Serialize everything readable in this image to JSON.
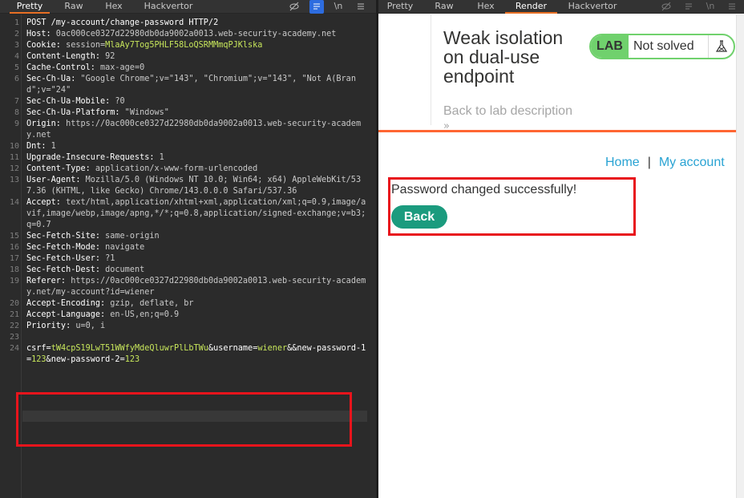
{
  "request_panel": {
    "tabs": [
      {
        "label": "Pretty",
        "active": true
      },
      {
        "label": "Raw",
        "active": false
      },
      {
        "label": "Hex",
        "active": false
      },
      {
        "label": "Hackvertor",
        "active": false
      }
    ],
    "toolbar_icons": [
      "eye-slash-icon",
      "wrap-lines-icon",
      "newline-icon",
      "menu-icon"
    ],
    "toolbar_newline_label": "\\n",
    "lines": [
      {
        "n": "1",
        "key": "POST /my-account/change-password HTTP/2",
        "val": ""
      },
      {
        "n": "2",
        "key": "Host:",
        "val": " 0ac000ce0327d22980db0da9002a0013.web-security-academy.net"
      },
      {
        "n": "3",
        "key": "Cookie:",
        "val": " session=",
        "green": "MlaAy7Tog5PHLF58LoQSRMMmqPJKlska"
      },
      {
        "n": "4",
        "key": "Content-Length:",
        "val": " 92"
      },
      {
        "n": "5",
        "key": "Cache-Control:",
        "val": " max-age=0"
      },
      {
        "n": "6",
        "key": "Sec-Ch-Ua:",
        "val": " \"Google Chrome\";v=\"143\", \"Chromium\";v=\"143\", \"Not A(Brand\";v=\"24\""
      },
      {
        "n": "7",
        "key": "Sec-Ch-Ua-Mobile:",
        "val": " ?0"
      },
      {
        "n": "8",
        "key": "Sec-Ch-Ua-Platform:",
        "val": " \"Windows\""
      },
      {
        "n": "9",
        "key": "Origin:",
        "val": " https://0ac000ce0327d22980db0da9002a0013.web-security-academy.net"
      },
      {
        "n": "10",
        "key": "Dnt:",
        "val": " 1"
      },
      {
        "n": "11",
        "key": "Upgrade-Insecure-Requests:",
        "val": " 1"
      },
      {
        "n": "12",
        "key": "Content-Type:",
        "val": " application/x-www-form-urlencoded"
      },
      {
        "n": "13",
        "key": "User-Agent:",
        "val": " Mozilla/5.0 (Windows NT 10.0; Win64; x64) AppleWebKit/537.36 (KHTML, like Gecko) Chrome/143.0.0.0 Safari/537.36"
      },
      {
        "n": "14",
        "key": "Accept:",
        "val": " text/html,application/xhtml+xml,application/xml;q=0.9,image/avif,image/webp,image/apng,*/*;q=0.8,application/signed-exchange;v=b3;q=0.7"
      },
      {
        "n": "15",
        "key": "Sec-Fetch-Site:",
        "val": " same-origin"
      },
      {
        "n": "16",
        "key": "Sec-Fetch-Mode:",
        "val": " navigate"
      },
      {
        "n": "17",
        "key": "Sec-Fetch-User:",
        "val": " ?1"
      },
      {
        "n": "18",
        "key": "Sec-Fetch-Dest:",
        "val": " document"
      },
      {
        "n": "19",
        "key": "Referer:",
        "val": " https://0ac000ce0327d22980db0da9002a0013.web-security-academy.net/my-account?id=wiener"
      },
      {
        "n": "20",
        "key": "Accept-Encoding:",
        "val": " gzip, deflate, br"
      },
      {
        "n": "21",
        "key": "Accept-Language:",
        "val": " en-US,en;q=0.9"
      },
      {
        "n": "22",
        "key": "Priority:",
        "val": " u=0, i"
      },
      {
        "n": "23",
        "key": "",
        "val": ""
      }
    ],
    "body_line": {
      "n": "24",
      "parts": [
        {
          "t": "csrf",
          "c": "k"
        },
        {
          "t": "=",
          "c": "o"
        },
        {
          "t": "tW4cpS19LwT51WWfyMdeQluwrPlLbTWu",
          "c": "g"
        },
        {
          "t": "&",
          "c": "o"
        },
        {
          "t": "username",
          "c": "k"
        },
        {
          "t": "=",
          "c": "o"
        },
        {
          "t": "wiener",
          "c": "g"
        },
        {
          "t": "&",
          "c": "o"
        },
        {
          "t": "&new-password-1",
          "c": "k"
        },
        {
          "t": "=",
          "c": "o"
        },
        {
          "t": "123",
          "c": "g"
        },
        {
          "t": "&",
          "c": "o"
        },
        {
          "t": "new-password-2",
          "c": "k"
        },
        {
          "t": "=",
          "c": "o"
        },
        {
          "t": "123",
          "c": "g"
        }
      ]
    }
  },
  "response_panel": {
    "tabs": [
      {
        "label": "Pretty",
        "active": false
      },
      {
        "label": "Raw",
        "active": false
      },
      {
        "label": "Hex",
        "active": false
      },
      {
        "label": "Render",
        "active": true
      },
      {
        "label": "Hackvertor",
        "active": false
      }
    ],
    "toolbar_icons": [
      "eye-slash-icon",
      "wrap-lines-icon",
      "newline-icon",
      "menu-icon"
    ],
    "toolbar_newline_label": "\\n",
    "lab": {
      "title": "Weak isolation on dual-use endpoint",
      "back_link": "Back to lab description",
      "chevron": "»",
      "badge_label": "LAB",
      "status": "Not solved"
    },
    "nav": {
      "home": "Home",
      "separator": "|",
      "account": "My account"
    },
    "message": "Password changed successfully!",
    "back_button": "Back"
  },
  "colors": {
    "accent_orange": "#e76f24",
    "highlight_red": "#e8141c",
    "lab_green": "#70d16d",
    "button_teal": "#1b9b7e",
    "link_blue": "#29a3d3",
    "value_green": "#c7e65b"
  }
}
